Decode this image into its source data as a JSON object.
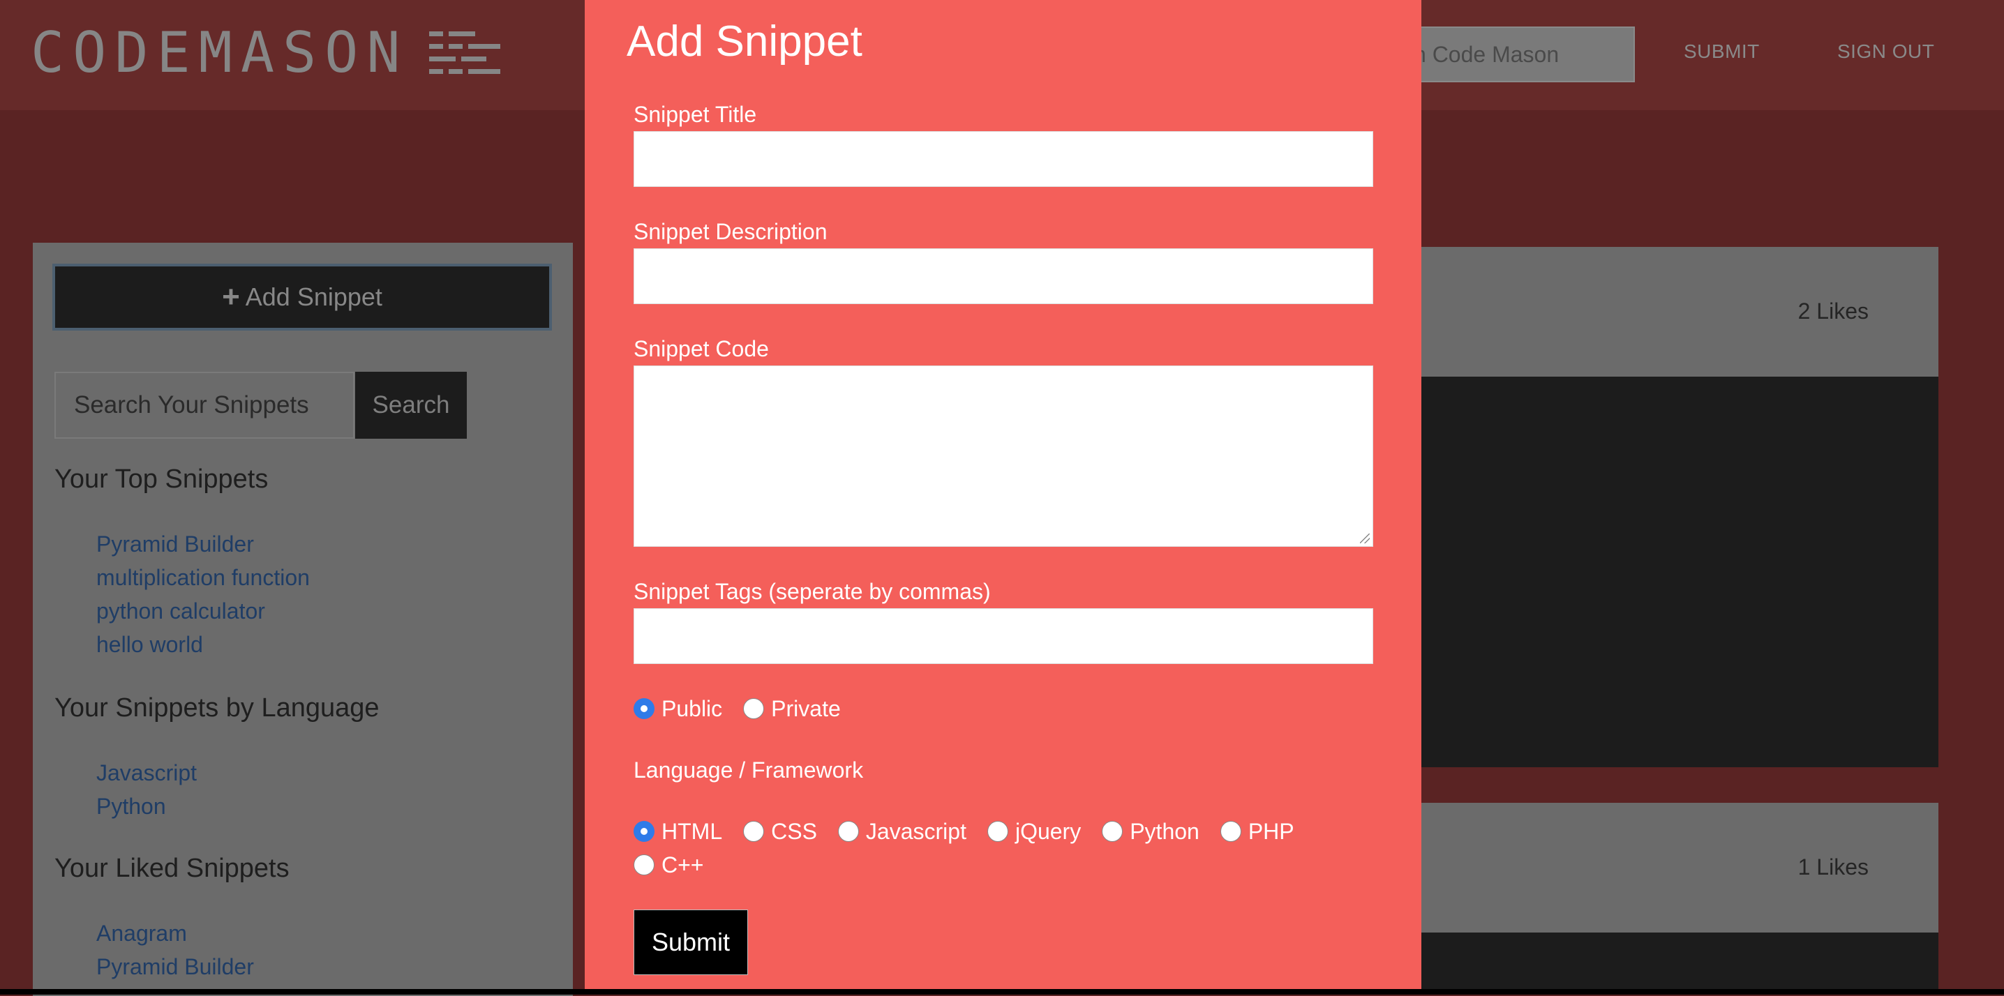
{
  "header": {
    "logo_text": "CODEMASON",
    "search_value": "ch Code Mason",
    "nav": {
      "submit": "SUBMIT",
      "sign_out": "SIGN OUT"
    }
  },
  "sidebar": {
    "add_button": "Add Snippet",
    "search_placeholder": "Search Your Snippets",
    "search_button": "Search",
    "top_heading": "Your Top Snippets",
    "top_snippets": [
      "Pyramid Builder",
      "multiplication function",
      "python calculator",
      "hello world"
    ],
    "language_heading": "Your Snippets by Language",
    "languages": [
      "Javascript",
      "Python"
    ],
    "liked_heading": "Your Liked Snippets",
    "liked_snippets": [
      "Anagram",
      "Pyramid Builder"
    ]
  },
  "cards": [
    {
      "likes": "2 Likes"
    },
    {
      "likes": "1 Likes"
    }
  ],
  "modal": {
    "title": "Add Snippet",
    "title_label": "Snippet Title",
    "description_label": "Snippet Description",
    "code_label": "Snippet Code",
    "tags_label": "Snippet Tags (seperate by commas)",
    "visibility_options": [
      {
        "label": "Public",
        "checked": true
      },
      {
        "label": "Private",
        "checked": false
      }
    ],
    "language_label": "Language / Framework",
    "language_options": [
      {
        "label": "HTML",
        "checked": true
      },
      {
        "label": "CSS",
        "checked": false
      },
      {
        "label": "Javascript",
        "checked": false
      },
      {
        "label": "jQuery",
        "checked": false
      },
      {
        "label": "Python",
        "checked": false
      },
      {
        "label": "PHP",
        "checked": false
      },
      {
        "label": "C++",
        "checked": false
      }
    ],
    "submit_label": "Submit"
  },
  "colors": {
    "modal_bg": "#f45f5a",
    "overlay": "#5a2323",
    "radio_checked": "#2f7be8"
  }
}
